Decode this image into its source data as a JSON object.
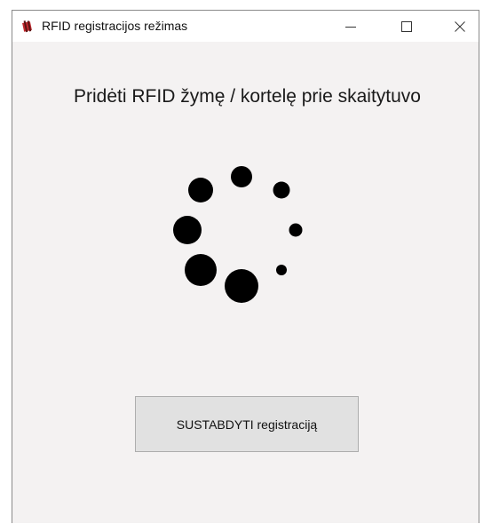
{
  "window": {
    "title": "RFID registracijos režimas",
    "icon": "rfid-app-icon",
    "controls": {
      "minimize_icon": "minimize-icon",
      "maximize_icon": "maximize-icon",
      "close_icon": "close-icon"
    }
  },
  "main": {
    "heading": "Pridėti RFID žymę / kortelę prie skaitytuvo",
    "spinner_icon": "loading-spinner-icon",
    "stop_button_label": "SUSTABDYTI registraciją"
  },
  "colors": {
    "titlebar": "#ffffff",
    "client_area": "#f4f2f2",
    "button_face": "#e1e1e1",
    "button_border": "#adadad",
    "spinner_dots": "#000000",
    "icon_accent": "#c0282d"
  }
}
